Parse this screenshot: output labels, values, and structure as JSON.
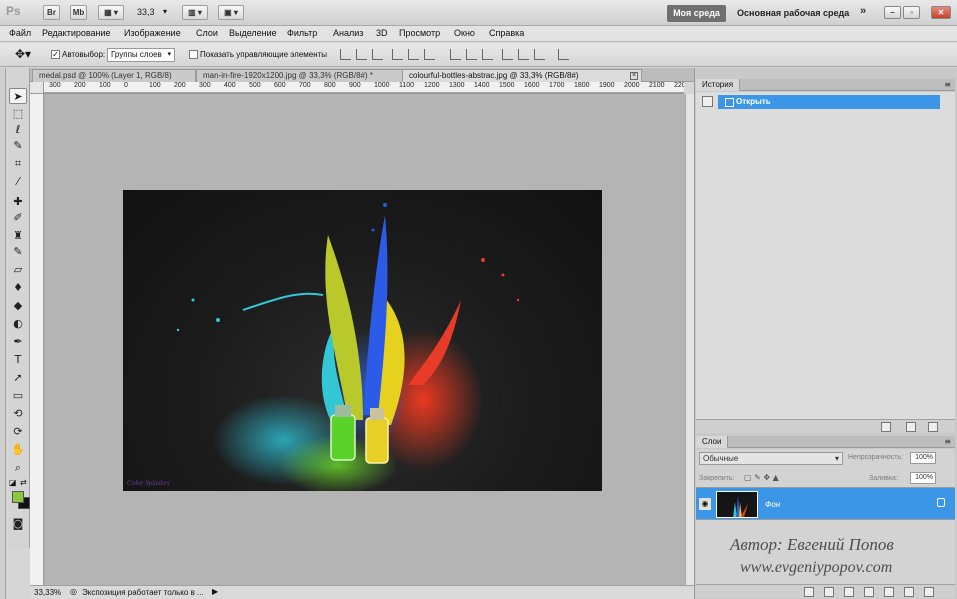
{
  "app": {
    "logo": "Ps",
    "launch_buttons": [
      "Br",
      "Mb"
    ],
    "zoom": "33,3",
    "workspace_active": "Моя среда",
    "workspace_default": "Основная рабочая среда",
    "more": "»"
  },
  "menu": [
    "Файл",
    "Редактирование",
    "Изображение",
    "Слои",
    "Выделение",
    "Фильтр",
    "Анализ",
    "3D",
    "Просмотр",
    "Окно",
    "Справка"
  ],
  "options": {
    "autoselect_label": "Автовыбор:",
    "autoselect_checked": "✓",
    "autoselect_value": "Группы слоев",
    "show_controls_label": "Показать управляющие элементы"
  },
  "tabs": [
    {
      "label": "medal.psd @ 100% (Layer 1, RGB/8)"
    },
    {
      "label": "man-in-fire-1920x1200.jpg @ 33,3% (RGB/8#) *"
    },
    {
      "label": "colourful-bottles-abstrac.jpg @ 33,3% (RGB/8#)"
    }
  ],
  "ruler_ticks": [
    "300",
    "200",
    "100",
    "0",
    "100",
    "200",
    "300",
    "400",
    "500",
    "600",
    "700",
    "800",
    "900",
    "1000",
    "1100",
    "1200",
    "1300",
    "1400",
    "1500",
    "1600",
    "1700",
    "1800",
    "1900",
    "2000",
    "2100",
    "220"
  ],
  "artwork": {
    "signature": "Color Splashes"
  },
  "status": {
    "zoom": "33,33%",
    "info": "Экспозиция работает только в ..."
  },
  "history_panel": {
    "title": "История",
    "items": [
      {
        "label": "Открыть"
      }
    ]
  },
  "layers_panel": {
    "title": "Слои",
    "blend_mode": "Обычные",
    "opacity_label": "Непрозрачность:",
    "opacity_value": "100%",
    "lock_label": "Закрепить:",
    "fill_label": "Заливка:",
    "fill_value": "100%",
    "layers": [
      {
        "name": "Фон"
      }
    ]
  },
  "watermark": {
    "author": "Автор: Евгений Попов",
    "site": "www.evgeniypopov.com"
  }
}
